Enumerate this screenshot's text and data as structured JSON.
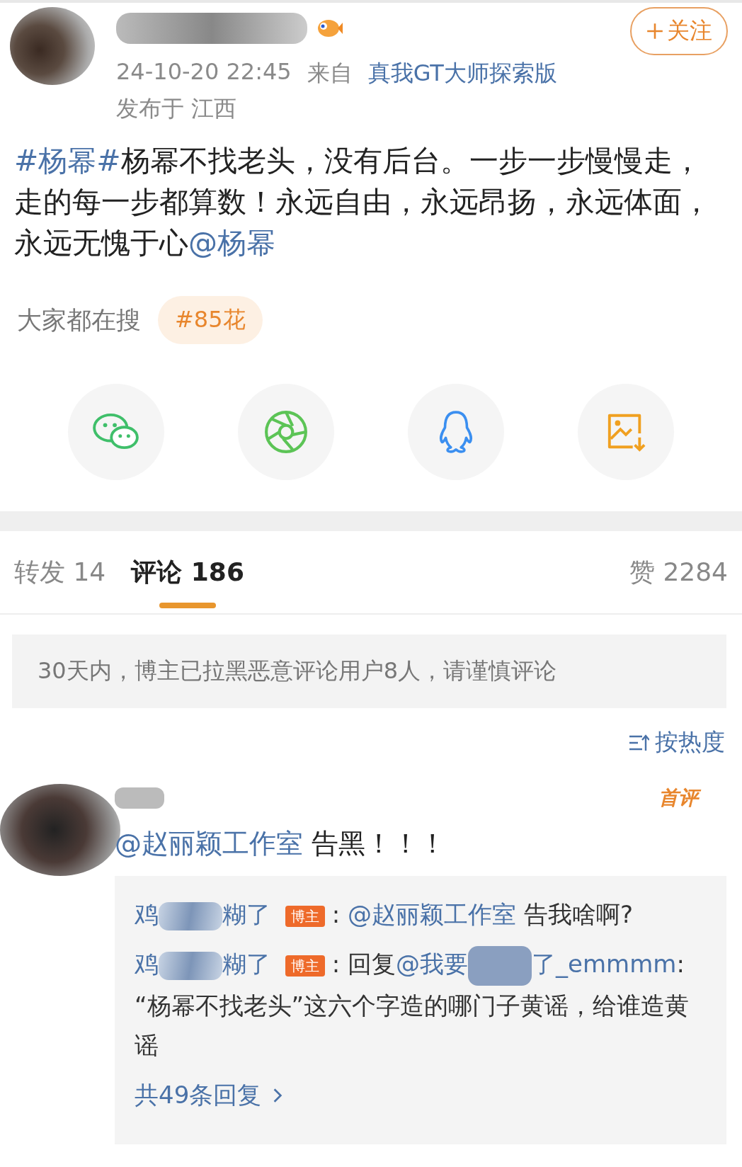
{
  "post": {
    "timestamp": "24-10-20 22:45",
    "source_label": "来自",
    "source": "真我GT大师探索版",
    "location": "发布于 江西",
    "follow_label": "关注",
    "text": [
      {
        "kind": "topic",
        "text": "#杨幂#"
      },
      {
        "kind": "plain",
        "text": "杨幂不找老头，没有后台。一步一步慢慢走，走的每一步都算数！永远自由，永远昂扬，永远体面，永远无愧于心"
      },
      {
        "kind": "mention",
        "text": "@杨幂"
      }
    ],
    "search_label": "大家都在搜",
    "search_tag": "#85花"
  },
  "share": [
    {
      "kind": "wechat"
    },
    {
      "kind": "moments"
    },
    {
      "kind": "qq"
    },
    {
      "kind": "save"
    }
  ],
  "tabs": [
    {
      "label": "转发 14",
      "selected": false
    },
    {
      "label": "评论 186",
      "selected": true
    }
  ],
  "likes": "赞 2284",
  "notice": "30天内，博主已拉黑恶意评论用户8人，请谨慎评论",
  "sort": "按热度",
  "comment": {
    "badge": "首评",
    "text": [
      {
        "kind": "mention",
        "text": "@赵丽颖工作室"
      },
      {
        "kind": "plain",
        "text": " 告黑！！！"
      }
    ],
    "replies": [
      {
        "author_start": "鸡",
        "author_end": "糊了",
        "badge": "博主",
        "text": [
          {
            "kind": "plain",
            "text": ": "
          },
          {
            "kind": "mention",
            "text": "@赵丽颖工作室"
          },
          {
            "kind": "plain",
            "text": " 告我啥啊?"
          }
        ]
      },
      {
        "author_start": "鸡",
        "author_end": "糊了",
        "badge": "博主",
        "text": [
          {
            "kind": "plain",
            "text": ": 回复"
          },
          {
            "kind": "mention",
            "text": "@我要"
          },
          {
            "kind": "redacted"
          },
          {
            "kind": "mention",
            "text": "了_emmmm"
          },
          {
            "kind": "plain",
            "text": ": “杨幂不找老头”这六个字造的哪门子黄谣，给谁造黄谣"
          }
        ]
      }
    ],
    "more_replies": "共49条回复"
  }
}
